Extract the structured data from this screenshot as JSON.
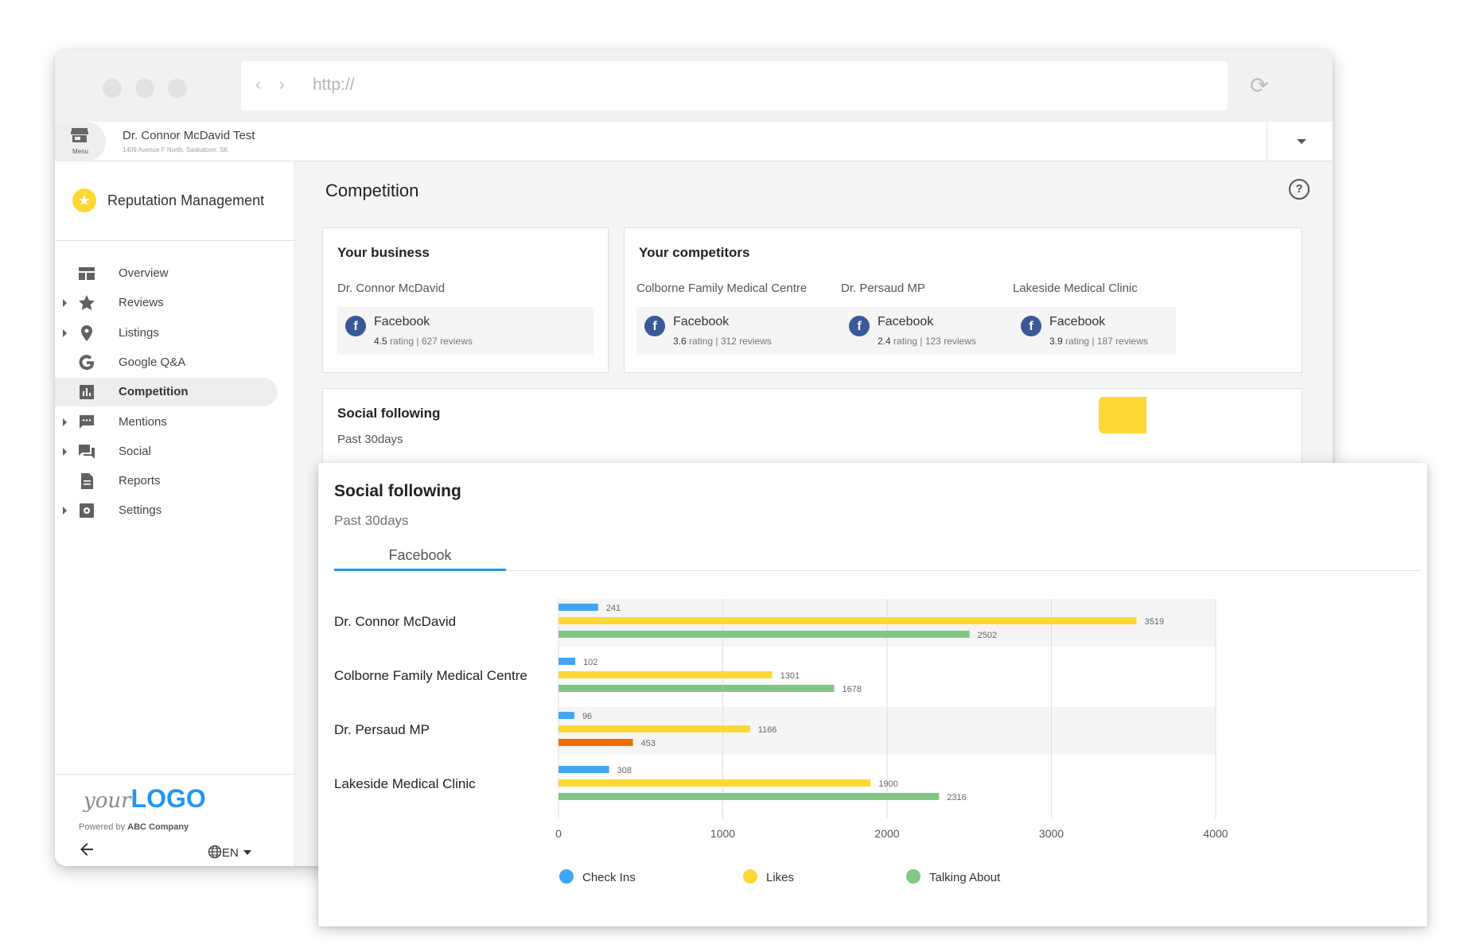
{
  "browser": {
    "url_placeholder": "http://"
  },
  "appbar": {
    "menu_label": "Menu",
    "account_name": "Dr. Connor McDavid Test",
    "account_address": "1409 Avenue F North, Saskatoon, SK"
  },
  "sidebar": {
    "product_title": "Reputation Management",
    "items": [
      {
        "label": "Overview",
        "icon": "overview-icon",
        "expandable": false,
        "active": false
      },
      {
        "label": "Reviews",
        "icon": "star-icon",
        "expandable": true,
        "active": false
      },
      {
        "label": "Listings",
        "icon": "location-pin-icon",
        "expandable": true,
        "active": false
      },
      {
        "label": "Google Q&A",
        "icon": "google-icon",
        "expandable": false,
        "active": false
      },
      {
        "label": "Competition",
        "icon": "bar-chart-icon",
        "expandable": false,
        "active": true
      },
      {
        "label": "Mentions",
        "icon": "chat-bubble-icon",
        "expandable": true,
        "active": false
      },
      {
        "label": "Social",
        "icon": "forum-icon",
        "expandable": true,
        "active": false
      },
      {
        "label": "Reports",
        "icon": "document-icon",
        "expandable": false,
        "active": false
      },
      {
        "label": "Settings",
        "icon": "settings-icon",
        "expandable": true,
        "active": false
      }
    ],
    "logo_your": "your",
    "logo_big": "LOGO",
    "powered_prefix": "Powered by",
    "powered_company": "ABC Company",
    "language": "EN"
  },
  "page": {
    "title": "Competition",
    "your_business": {
      "heading": "Your business",
      "name": "Dr. Connor McDavid",
      "source": "Facebook",
      "rating": "4.5",
      "rating_suffix": "rating | 627 reviews"
    },
    "competitors": {
      "heading": "Your competitors",
      "items": [
        {
          "name": "Colborne Family Medical Centre",
          "source": "Facebook",
          "rating": "3.6",
          "rating_suffix": "rating | 312 reviews"
        },
        {
          "name": "Dr. Persaud MP",
          "source": "Facebook",
          "rating": "2.4",
          "rating_suffix": "rating | 123 reviews"
        },
        {
          "name": "Lakeside Medical Clinic",
          "source": "Facebook",
          "rating": "3.9",
          "rating_suffix": "rating | 187 reviews"
        }
      ]
    },
    "social_behind": {
      "title": "Social following",
      "subtitle": "Past 30days"
    }
  },
  "social_card": {
    "title": "Social following",
    "subtitle": "Past 30days",
    "tab": "Facebook"
  },
  "colors": {
    "check_ins": "#42a5f5",
    "likes": "#fdd835",
    "talking_about": "#81c784",
    "highlight": "#ef6c00",
    "accent": "#2196f3"
  },
  "chart_data": {
    "type": "bar",
    "orientation": "horizontal",
    "categories": [
      "Dr. Connor McDavid",
      "Colborne Family Medical Centre",
      "Dr. Persaud MP",
      "Lakeside Medical Clinic"
    ],
    "series": [
      {
        "name": "Check Ins",
        "values": [
          241,
          102,
          96,
          308
        ]
      },
      {
        "name": "Likes",
        "values": [
          3519,
          1301,
          1166,
          1900
        ]
      },
      {
        "name": "Talking About",
        "values": [
          2502,
          1678,
          453,
          2316
        ]
      }
    ],
    "xlim": [
      0,
      4000
    ],
    "xticks": [
      0,
      1000,
      2000,
      3000,
      4000
    ],
    "legend": "bottom",
    "grid": true
  }
}
